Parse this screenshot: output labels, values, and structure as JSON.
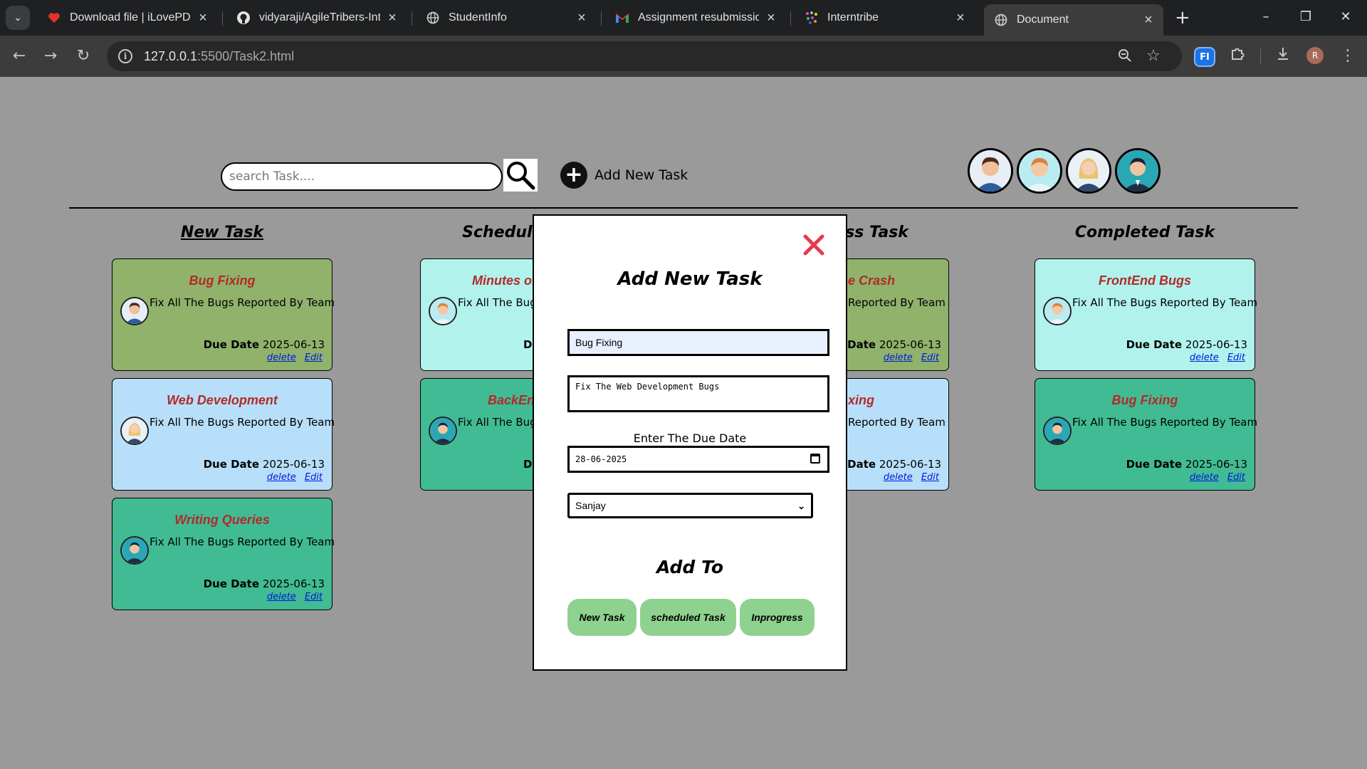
{
  "browser": {
    "tabs": [
      {
        "title": "Download file | iLovePDF",
        "favicon": "heart-icon"
      },
      {
        "title": "vidyaraji/AgileTribers-Intern",
        "favicon": "github-icon"
      },
      {
        "title": "StudentInfo",
        "favicon": "globe-icon"
      },
      {
        "title": "Assignment resubmission c",
        "favicon": "gmail-icon"
      },
      {
        "title": "Interntribe",
        "favicon": "dots-icon"
      },
      {
        "title": "Document",
        "favicon": "globe-icon"
      }
    ],
    "url_host": "127.0.0.1",
    "url_rest": ":5500/Task2.html",
    "profile_initial": "R",
    "extension_label": "FI"
  },
  "header": {
    "search_placeholder": "search Task....",
    "add_task_label": "Add New Task",
    "team_avatars": [
      "man-avatar",
      "red-hair-man-avatar",
      "blonde-woman-avatar",
      "suited-man-avatar"
    ]
  },
  "columns": [
    {
      "title": "New Task"
    },
    {
      "title": "Scheduled Task"
    },
    {
      "title": "Inprogress Task"
    },
    {
      "title": "Completed Task"
    }
  ],
  "cards": {
    "new": [
      {
        "title": "Bug Fixing",
        "desc": "Fix All The Bugs Reported By Team",
        "due_label": "Due Date",
        "due": "2025-06-13",
        "delete": "delete",
        "edit": "Edit"
      },
      {
        "title": "Web Development",
        "desc": "Fix All The Bugs Reported By Team",
        "due_label": "Due Date",
        "due": "2025-06-13",
        "delete": "delete",
        "edit": "Edit"
      },
      {
        "title": "Writing Queries",
        "desc": "Fix All The Bugs Reported By Team",
        "due_label": "Due Date",
        "due": "2025-06-13",
        "delete": "delete",
        "edit": "Edit"
      }
    ],
    "scheduled": [
      {
        "title": "Minutes of",
        "desc": "Fix All The Bugs",
        "due_label": "Du"
      },
      {
        "title": "BackEn",
        "desc": "Fix All The Bugs",
        "due_label": "Du"
      }
    ],
    "inprogress": [
      {
        "title": "e Crash",
        "desc": "Reported By Team",
        "due_label": "e Date",
        "due": "2025-06-13",
        "delete": "delete",
        "edit": "Edit"
      },
      {
        "title": "xing",
        "desc": "Reported By Team",
        "due_label": "e Date",
        "due": "2025-06-13",
        "delete": "delete",
        "edit": "Edit"
      }
    ],
    "completed": [
      {
        "title": "FrontEnd Bugs",
        "desc": "Fix All The Bugs Reported By Team",
        "due_label": "Due Date",
        "due": "2025-06-13",
        "delete": "delete",
        "edit": "Edit"
      },
      {
        "title": "Bug Fixing",
        "desc": "Fix All The Bugs Reported By Team",
        "due_label": "Due Date",
        "due": "2025-06-13",
        "delete": "delete",
        "edit": "Edit"
      }
    ]
  },
  "modal": {
    "title": "Add New Task",
    "task_name_value": "Bug Fixing",
    "task_desc_value": "Fix The Web Development Bugs",
    "due_label": "Enter The Due Date",
    "due_value": "28-06-2025",
    "assignee_value": "Sanjay",
    "add_to_label": "Add To",
    "buttons": [
      "New Task",
      "scheduled Task",
      "Inprogress"
    ]
  },
  "colors": {
    "page_bg": "#9a9a9a",
    "card_green": "#90b26b",
    "card_light_blue": "#b8dff9",
    "card_teal": "#41bb93",
    "card_mint": "#b1f3ec",
    "card_title": "#b22a2a",
    "close_icon": "#e63950",
    "modal_button": "#8fd18f"
  }
}
